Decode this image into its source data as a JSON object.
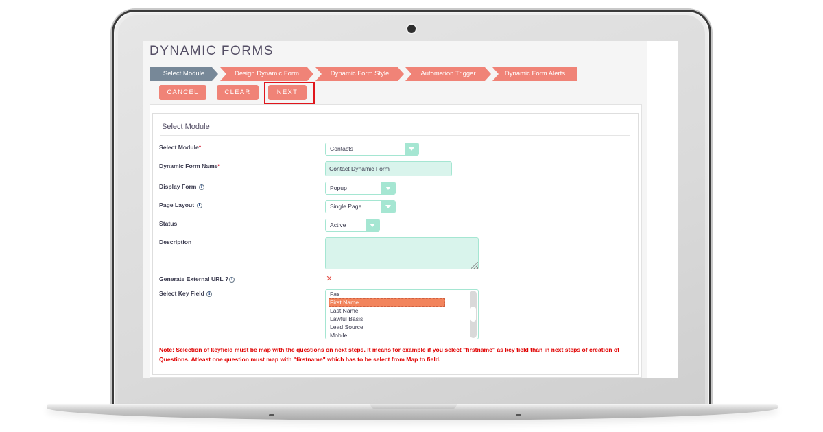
{
  "page": {
    "title": "DYNAMIC FORMS"
  },
  "steps": [
    {
      "label": "Select Module",
      "active": true
    },
    {
      "label": "Design Dynamic Form",
      "active": false
    },
    {
      "label": "Dynamic Form Style",
      "active": false
    },
    {
      "label": "Automation Trigger",
      "active": false
    },
    {
      "label": "Dynamic Form Alerts",
      "active": false
    }
  ],
  "actions": {
    "cancel": "CANCEL",
    "clear": "CLEAR",
    "next": "NEXT"
  },
  "panel": {
    "title": "Select Module"
  },
  "form": {
    "select_module": {
      "label": "Select Module",
      "required": "*",
      "value": "Contacts"
    },
    "form_name": {
      "label": "Dynamic Form Name",
      "required": "*",
      "value": "Contact Dynamic Form"
    },
    "display_form": {
      "label": "Display Form",
      "value": "Popup"
    },
    "page_layout": {
      "label": "Page Layout",
      "value": "Single Page"
    },
    "status": {
      "label": "Status",
      "value": "Active"
    },
    "description": {
      "label": "Description",
      "value": ""
    },
    "external_url": {
      "label": "Generate External URL ?",
      "checked": false,
      "glyph": "✕"
    },
    "key_field": {
      "label": "Select Key Field",
      "options": [
        "Fax",
        "First Name",
        "Last Name",
        "Lawful Basis",
        "Lead Source",
        "Mobile"
      ],
      "selected": "First Name"
    },
    "info_glyph": "i"
  },
  "note": "Note: Selection of keyfield must be map with the questions on next steps. It means for example if you select \"firstname\" as key field than in next steps of creation of Questions. Atleast one question must map with \"firstname\" which has to be select from Map to field.",
  "colors": {
    "step_active": "#778898",
    "step_inactive": "#f08377",
    "button": "#f08377",
    "highlight": "#e0161c",
    "input_border": "#a5e6d2",
    "input_fill": "#d9f4ec",
    "selected_option": "#f2845c",
    "note_text": "#e00000"
  }
}
